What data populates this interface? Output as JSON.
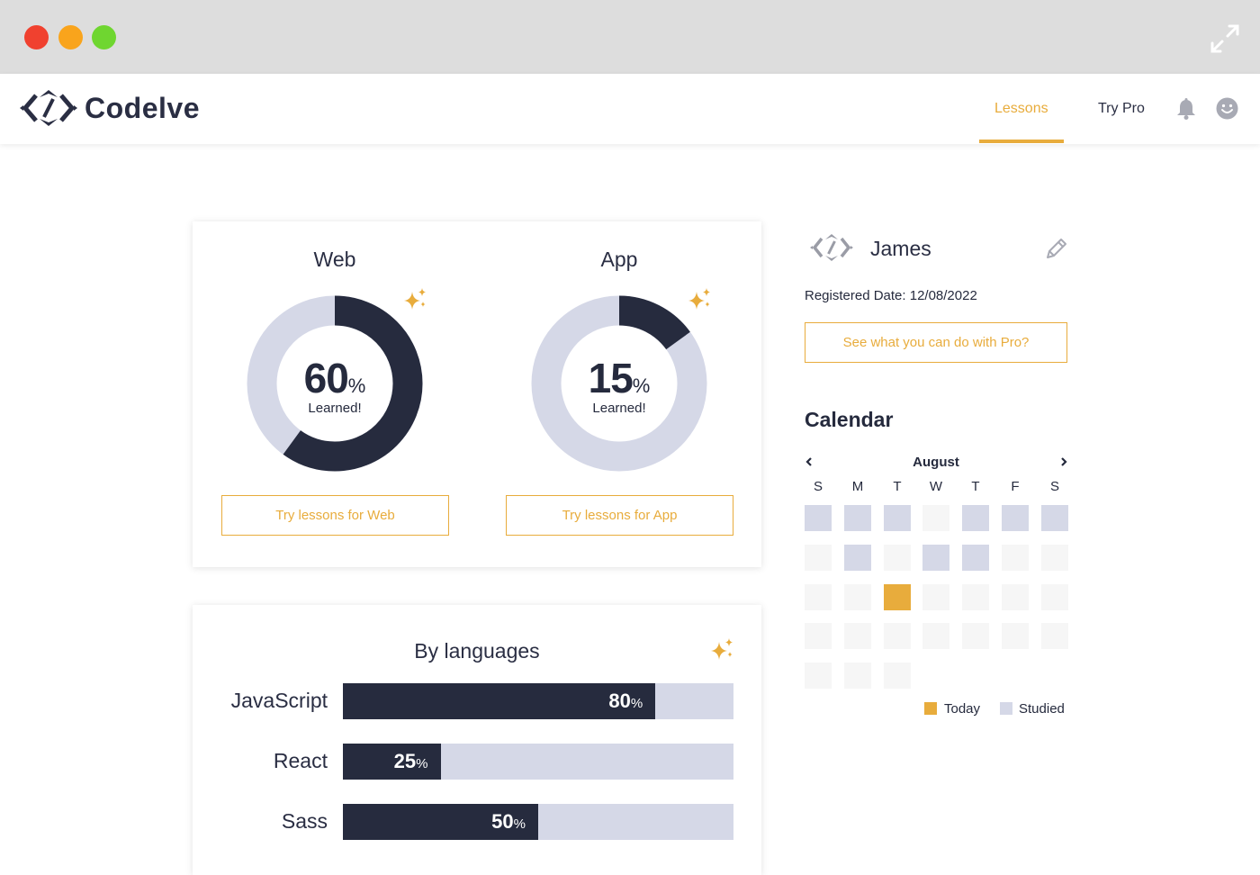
{
  "window": {
    "controls": [
      "close",
      "minimize",
      "maximize"
    ],
    "expand_icon": "expand-icon"
  },
  "navbar": {
    "brand": "Codelve",
    "links": [
      {
        "label": "Lessons",
        "active": true
      },
      {
        "label": "Try Pro",
        "active": false
      }
    ],
    "icons": [
      "bell-icon",
      "smiley-icon"
    ]
  },
  "progress": [
    {
      "title": "Web",
      "percent": 60,
      "value_text": "60",
      "percent_sign": "%",
      "caption": "Learned!",
      "button": "Try lessons for Web"
    },
    {
      "title": "App",
      "percent": 15,
      "value_text": "15",
      "percent_sign": "%",
      "caption": "Learned!",
      "button": "Try lessons for App"
    }
  ],
  "languages": {
    "title": "By languages",
    "items": [
      {
        "name": "JavaScript",
        "percent": 80,
        "value_text": "80",
        "percent_sign": "%"
      },
      {
        "name": "React",
        "percent": 25,
        "value_text": "25",
        "percent_sign": "%"
      },
      {
        "name": "Sass",
        "percent": 50,
        "value_text": "50",
        "percent_sign": "%"
      }
    ]
  },
  "profile": {
    "name": "James",
    "registered": "Registered Date: 12/08/2022",
    "pro_button": "See what you can do with Pro?"
  },
  "calendar": {
    "heading": "Calendar",
    "month": "August",
    "days": [
      "S",
      "M",
      "T",
      "W",
      "T",
      "F",
      "S"
    ],
    "rows": [
      [
        "studied",
        "studied",
        "studied",
        "empty",
        "studied",
        "studied",
        "studied"
      ],
      [
        "empty",
        "studied",
        "empty",
        "studied",
        "studied",
        "empty",
        "empty"
      ],
      [
        "empty",
        "empty",
        "today",
        "empty",
        "empty",
        "empty",
        "empty"
      ],
      [
        "empty",
        "empty",
        "empty",
        "empty",
        "empty",
        "empty",
        "empty"
      ],
      [
        "empty",
        "empty",
        "empty"
      ]
    ],
    "legend": [
      {
        "label": "Today",
        "color": "#e8ac3c"
      },
      {
        "label": "Studied",
        "color": "#d5d8e7"
      }
    ]
  },
  "colors": {
    "accent": "#e8ac3c",
    "dark": "#262b3e",
    "track": "#d5d8e7",
    "empty_cell": "#f6f6f6"
  }
}
